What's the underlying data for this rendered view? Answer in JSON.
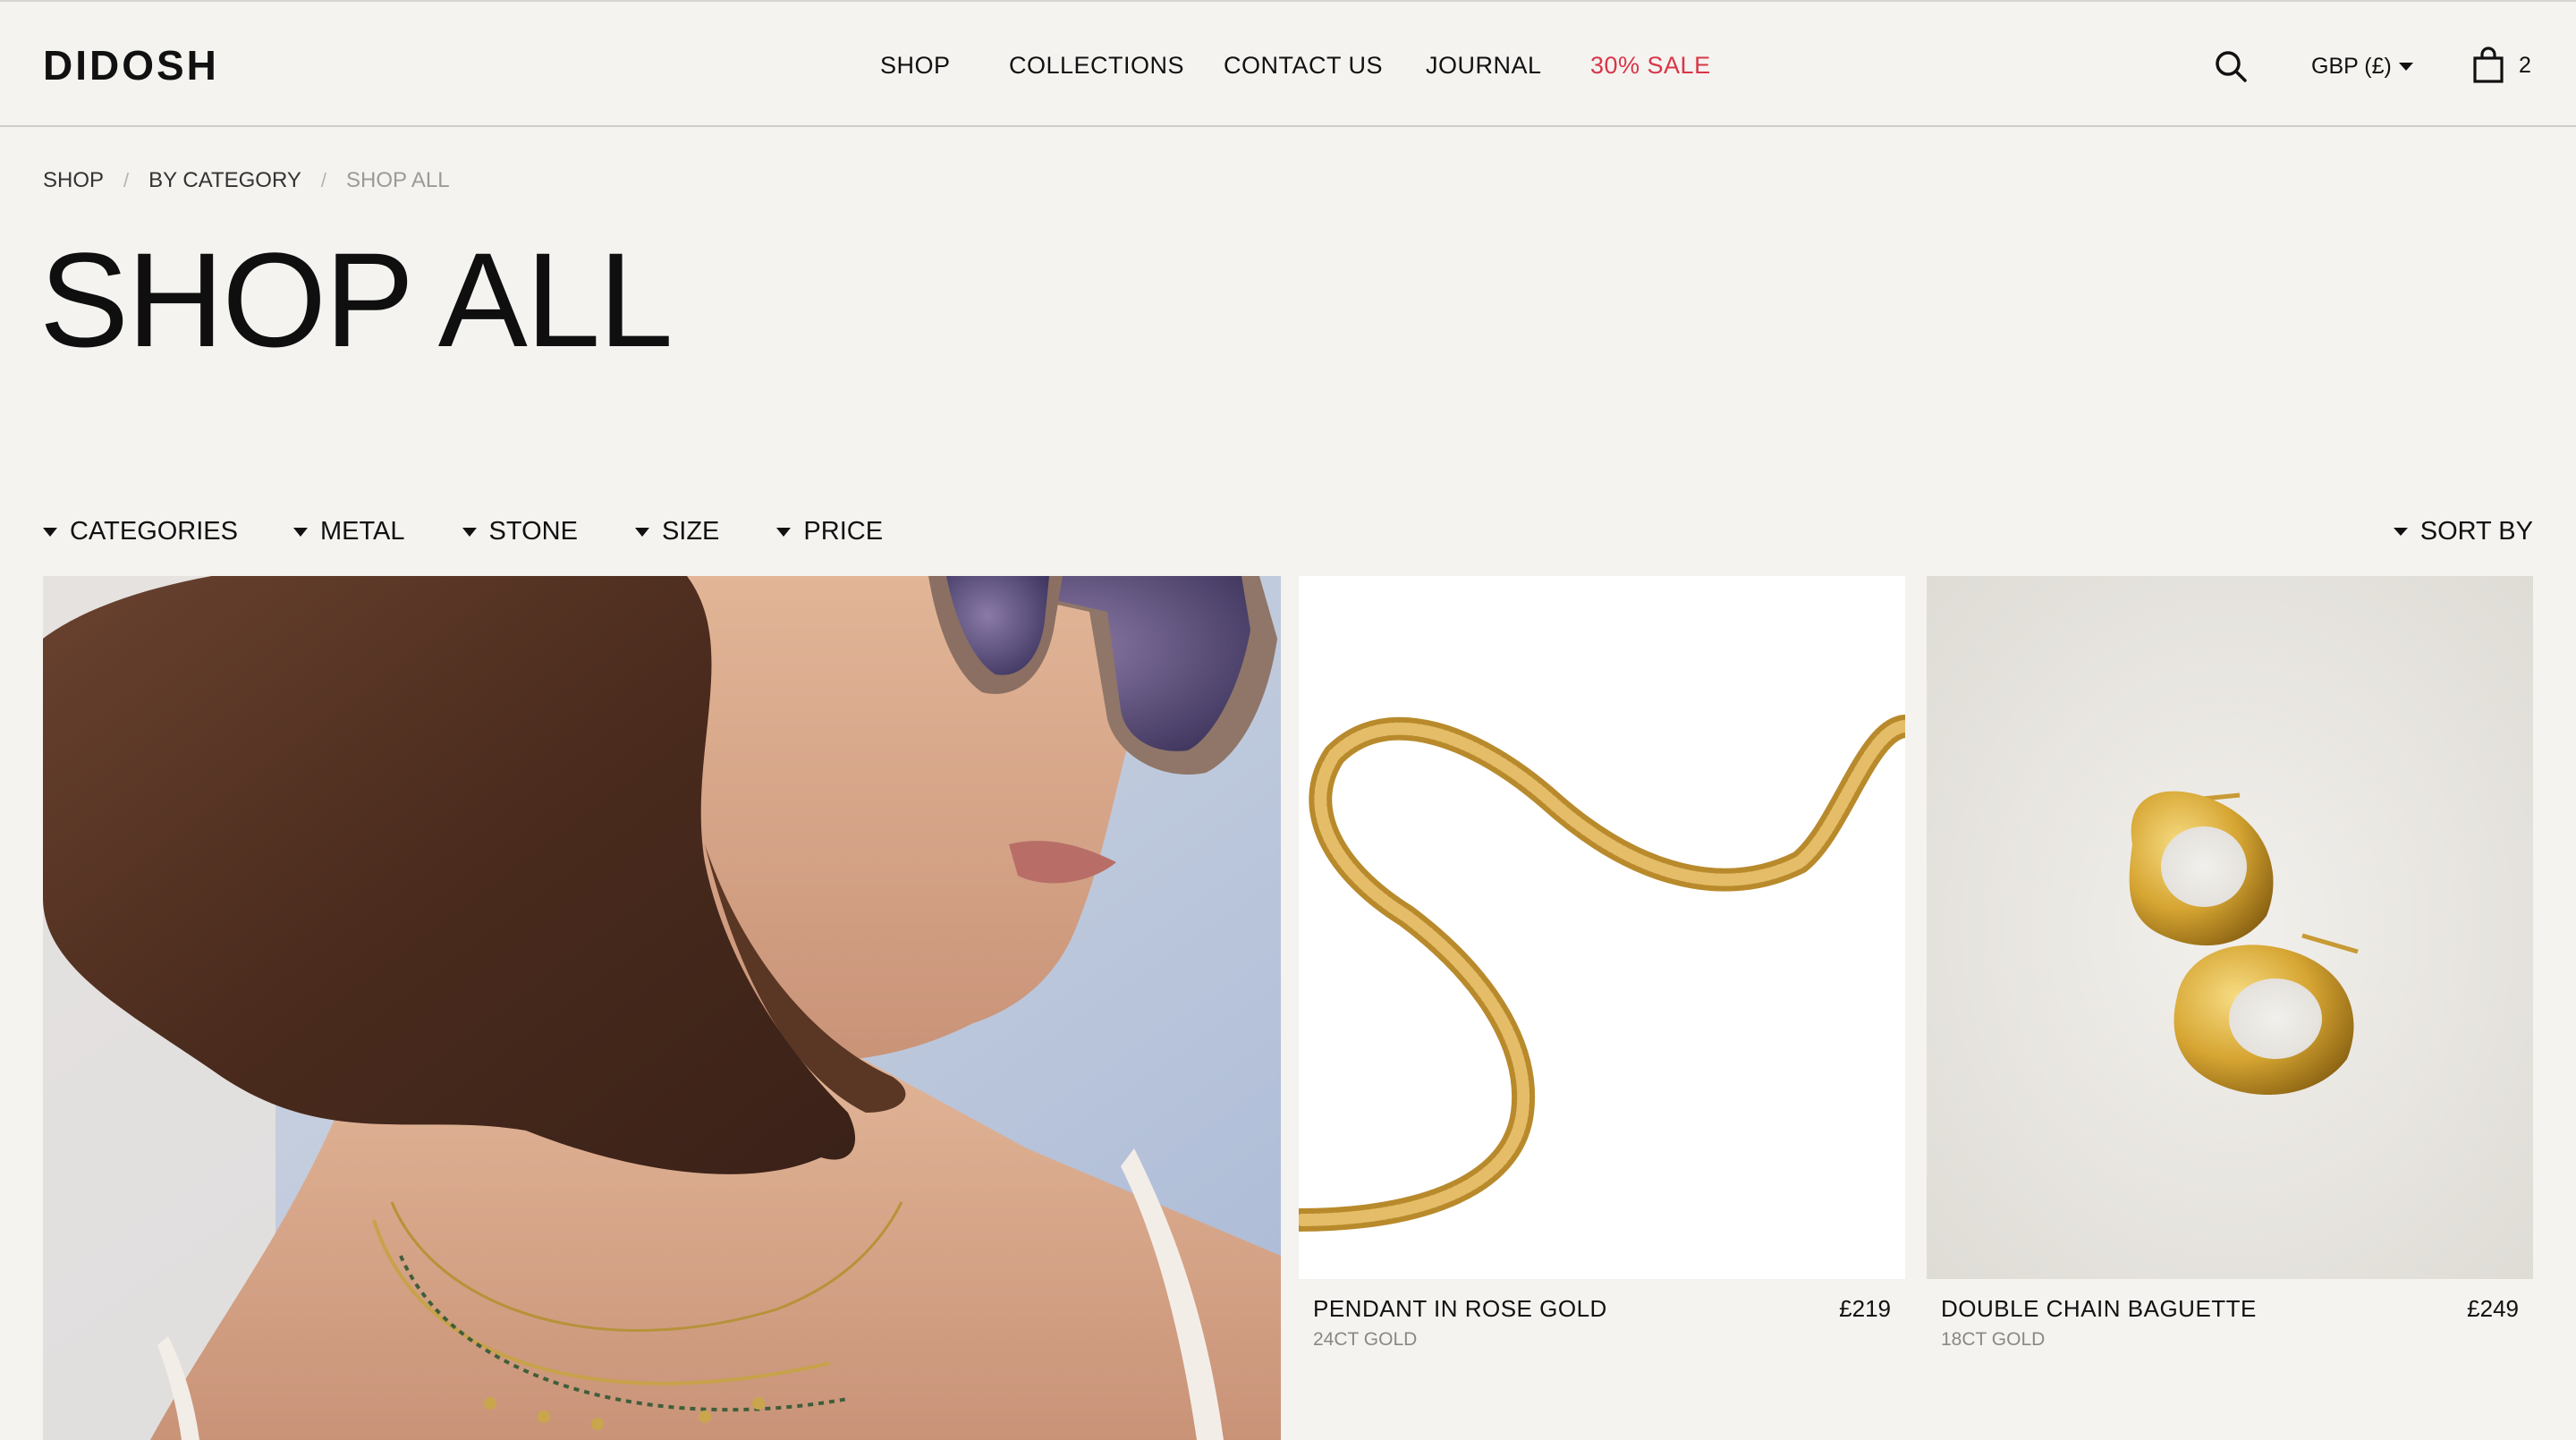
{
  "brand": {
    "logo": "DIDOSH"
  },
  "nav": {
    "items": [
      {
        "label": "SHOP"
      },
      {
        "label": "COLLECTIONS"
      },
      {
        "label": "CONTACT US"
      },
      {
        "label": "JOURNAL"
      },
      {
        "label": "30% SALE"
      }
    ],
    "sale_color": "#d93548"
  },
  "header": {
    "search_icon": "search-icon",
    "currency": "GBP (£)",
    "cart_icon": "bag-icon",
    "cart_count": "2"
  },
  "breadcrumb": [
    {
      "label": "SHOP"
    },
    {
      "label": "BY CATEGORY"
    },
    {
      "label": "SHOP ALL"
    }
  ],
  "page": {
    "title": "SHOP ALL"
  },
  "filters": [
    {
      "label": "CATEGORIES"
    },
    {
      "label": "METAL"
    },
    {
      "label": "STONE"
    },
    {
      "label": "SIZE"
    },
    {
      "label": "PRICE"
    }
  ],
  "sort": {
    "label": "SORT BY"
  },
  "products": [
    {
      "name": "PENDANT IN ROSE GOLD",
      "price": "£219",
      "material": "24CT GOLD"
    },
    {
      "name": "DOUBLE CHAIN BAGUETTE",
      "price": "£249",
      "material": "18CT GOLD"
    }
  ]
}
